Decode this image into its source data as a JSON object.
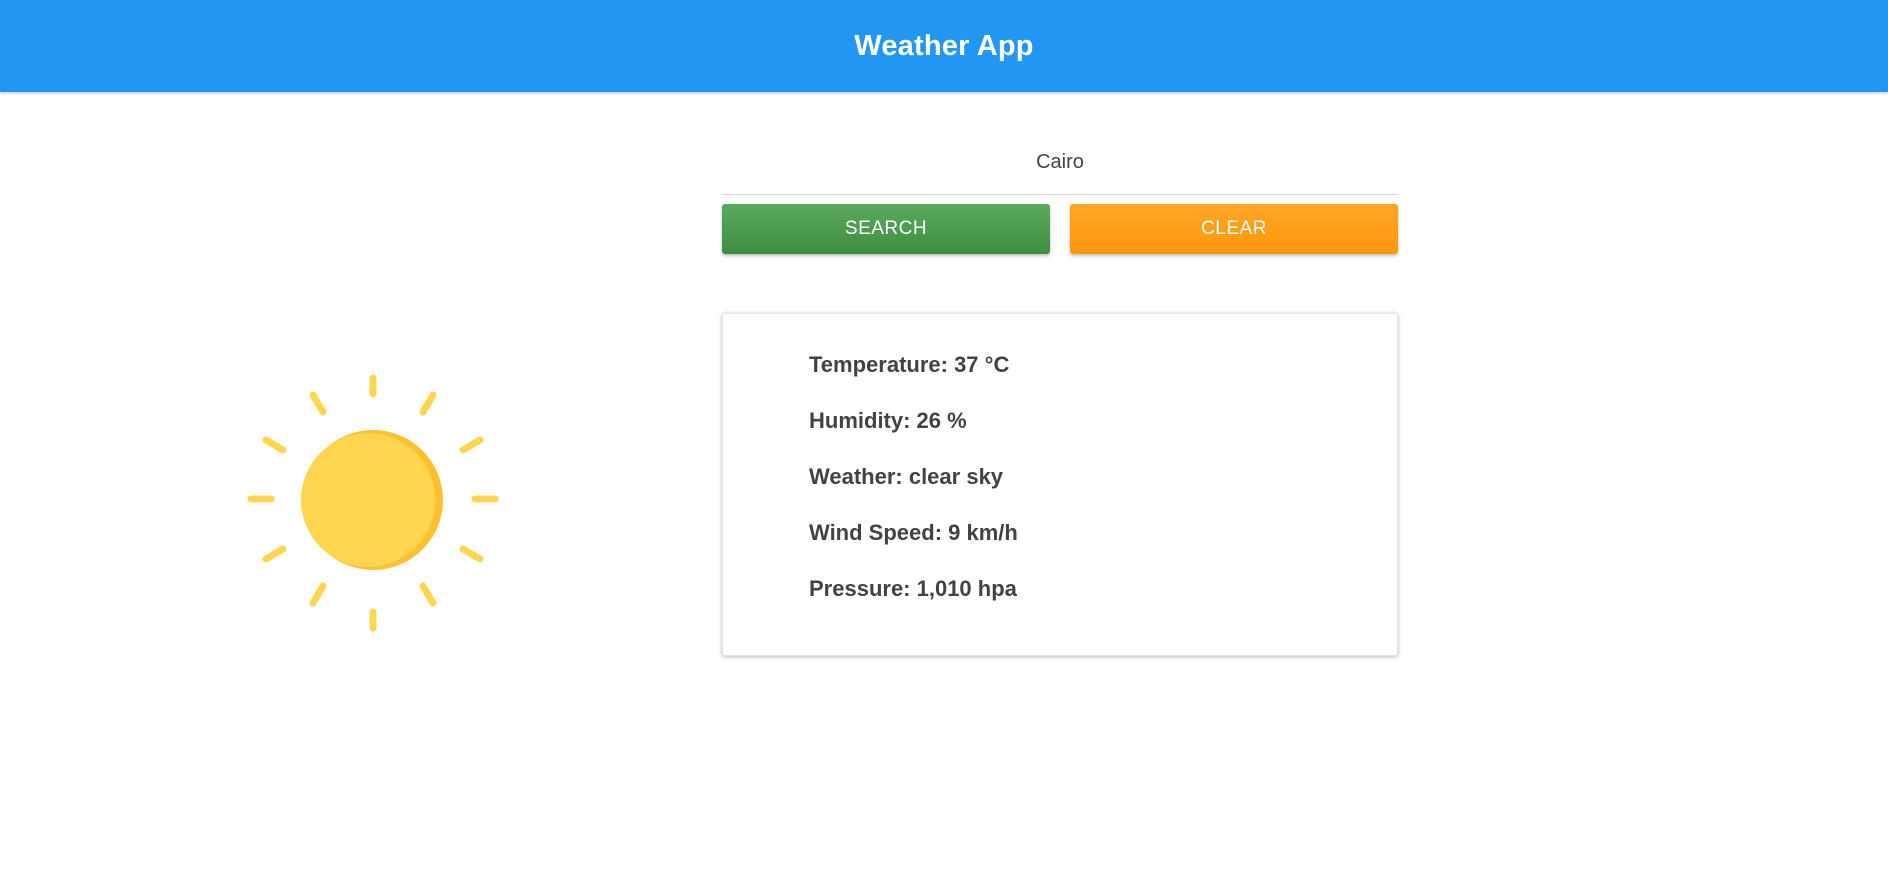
{
  "app": {
    "title": "Weather App"
  },
  "search": {
    "value": "Cairo",
    "placeholder": ""
  },
  "buttons": {
    "search_label": "SEARCH",
    "clear_label": "CLEAR"
  },
  "weather_icon": {
    "name": "sun-icon",
    "color": "#FFD54F",
    "shade_color": "#FFC02E"
  },
  "details": {
    "temperature": "Temperature: 37 °C",
    "humidity": "Humidity: 26 %",
    "weather": "Weather: clear sky",
    "wind_speed": "Wind Speed: 9 km/h",
    "pressure": "Pressure: 1,010 hpa"
  },
  "colors": {
    "app_bar": "#2196F3",
    "search_button": "#4CAF50",
    "clear_button": "#FF9800",
    "text": "#424242"
  }
}
